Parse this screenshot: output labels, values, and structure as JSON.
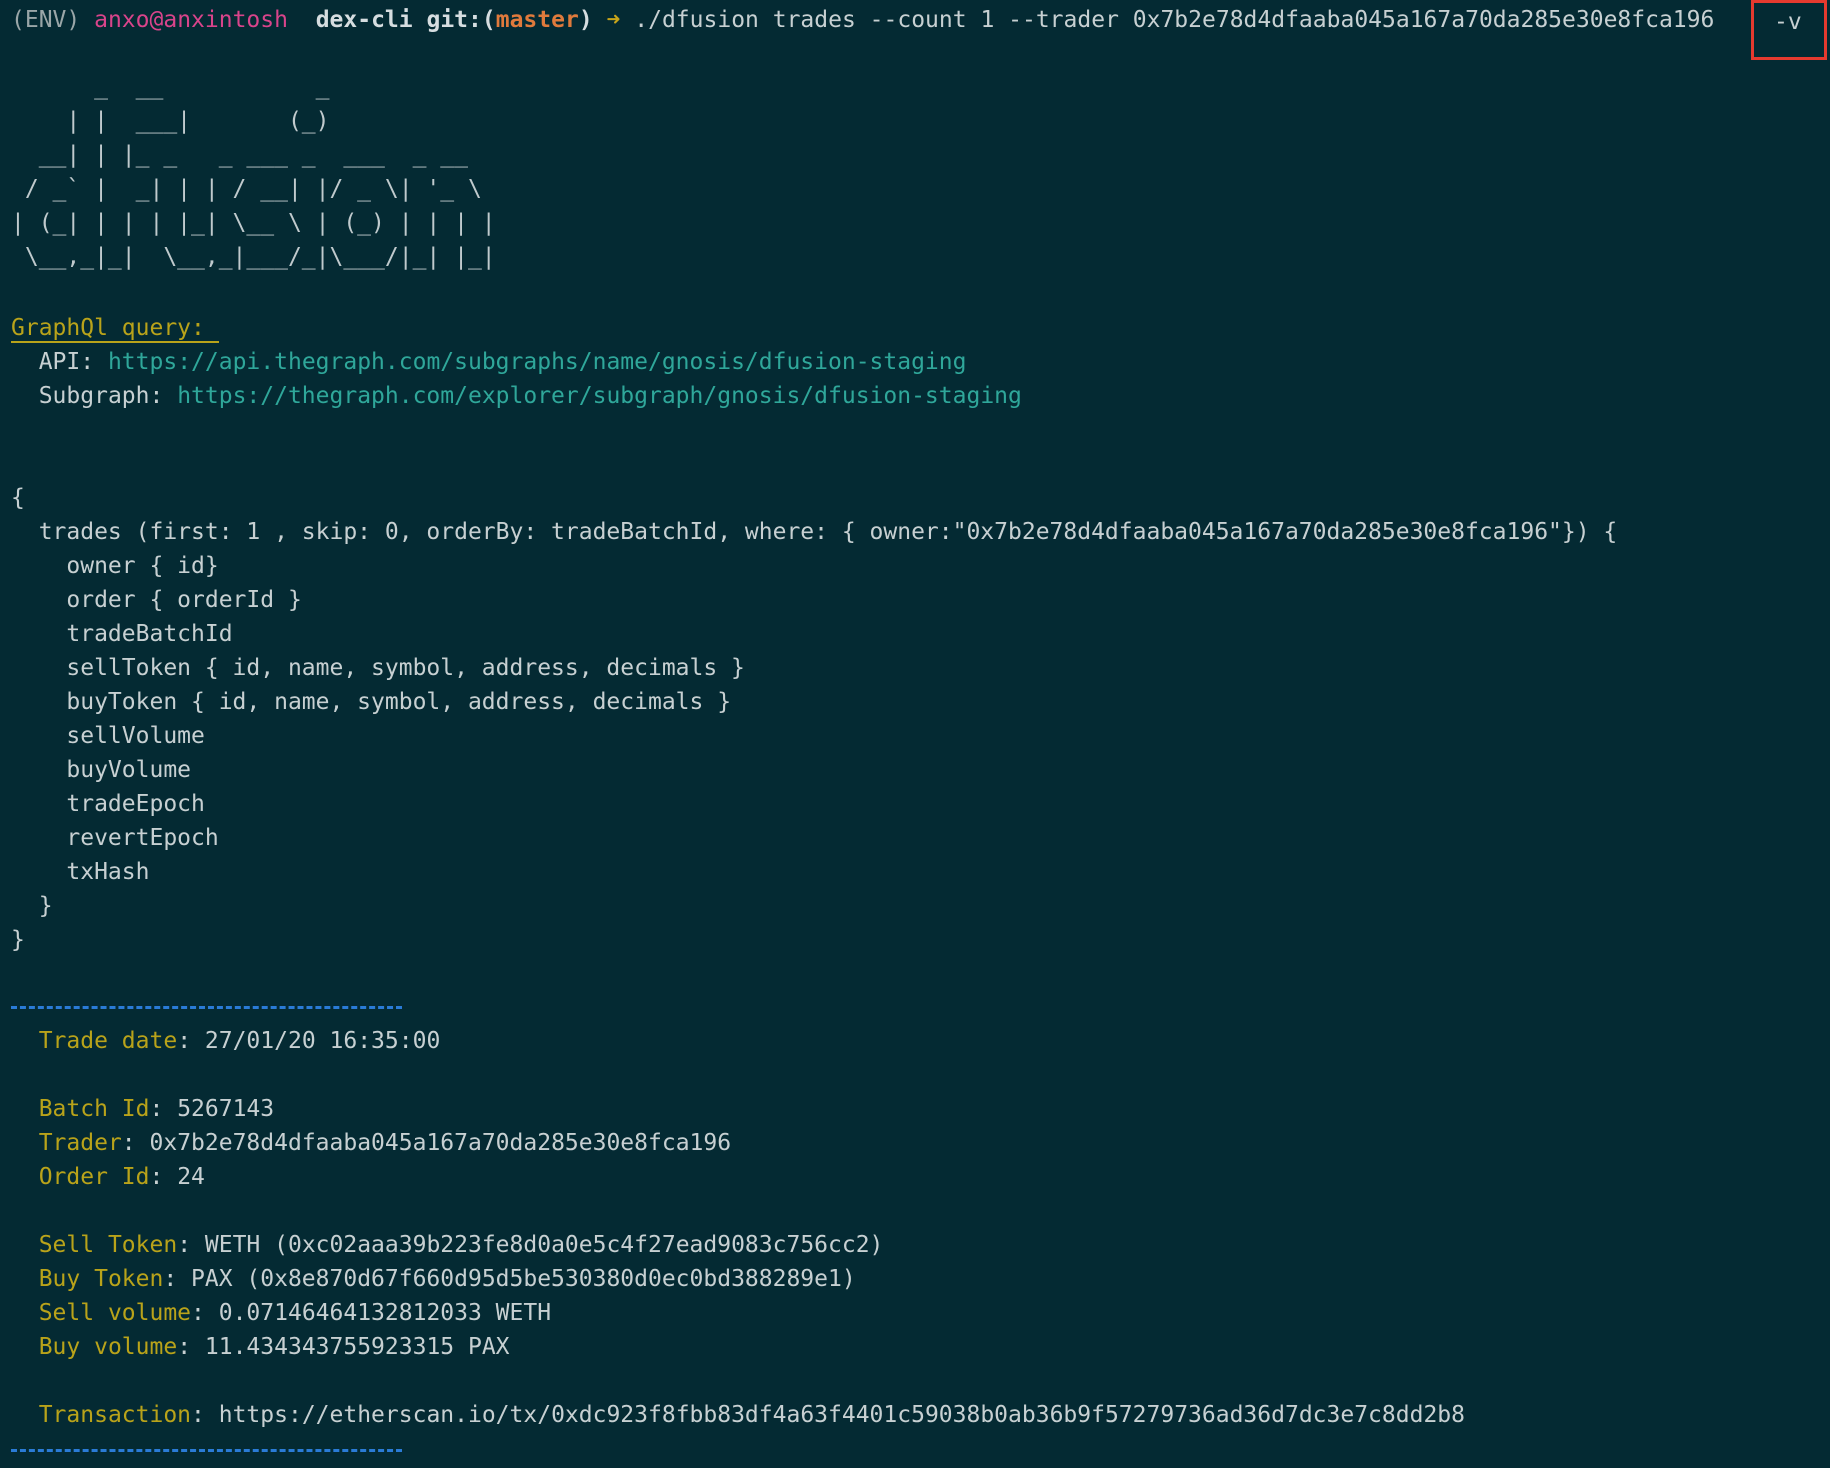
{
  "prompt": {
    "env": "(ENV)",
    "user": "anxo",
    "host": "@anxintosh",
    "dir": "dex-cli",
    "git_label": "git:(",
    "branch": "master",
    "git_close": ")",
    "arrow": "➜",
    "command": "./dfusion trades --count 1 --trader 0x7b2e78d4dfaaba045a167a70da285e30e8fca196",
    "flag": "-v"
  },
  "banner": [
    "      _  __           _",
    "    | |  ___|       (_)",
    "  __| | |_ _   _ ___ _  ___  _ __",
    " / _` |  _| | | / __| |/ _ \\| '_ \\",
    "| (_| | | | |_| \\__ \\ | (_) | | | |",
    " \\__,_|_|  \\__,_|___/_|\\___/|_| |_|"
  ],
  "query_section": {
    "title": "GraphQl query: ",
    "api_label": "API: ",
    "api_url": "https://api.thegraph.com/subgraphs/name/gnosis/dfusion-staging",
    "subgraph_label": "Subgraph: ",
    "subgraph_url": "https://thegraph.com/explorer/subgraph/gnosis/dfusion-staging"
  },
  "query_lines": [
    "{",
    "  trades (first: 1 , skip: 0, orderBy: tradeBatchId, where: { owner:\"0x7b2e78d4dfaaba045a167a70da285e30e8fca196\"}) {",
    "    owner { id}",
    "    order { orderId }",
    "    tradeBatchId",
    "    sellToken { id, name, symbol, address, decimals }",
    "    buyToken { id, name, symbol, address, decimals }",
    "    sellVolume",
    "    buyVolume",
    "    tradeEpoch",
    "    revertEpoch",
    "    txHash",
    "  }",
    "}"
  ],
  "trade": {
    "date_label": "Trade date",
    "date_value": "27/01/20 16:35:00",
    "batch_label": "Batch Id",
    "batch_value": "5267143",
    "trader_label": "Trader",
    "trader_value": "0x7b2e78d4dfaaba045a167a70da285e30e8fca196",
    "order_label": "Order Id",
    "order_value": "24",
    "sell_token_label": "Sell Token",
    "sell_token_value": "WETH (0xc02aaa39b223fe8d0a0e5c4f27ead9083c756cc2)",
    "buy_token_label": "Buy Token",
    "buy_token_value": "PAX (0x8e870d67f660d95d5be530380d0ec0bd388289e1)",
    "sell_volume_label": "Sell volume",
    "sell_volume_value": "0.07146464132812033 WETH",
    "buy_volume_label": "Buy volume",
    "buy_volume_value": "11.434343755923315 PAX",
    "tx_label": "Transaction",
    "tx_value": "https://etherscan.io/tx/0xdc923f8fbb83df4a63f4401c59038b0ab36b9f57279736ad36d7dc3e7c8dd2b8"
  },
  "colors": {
    "background": "#042a33",
    "user": "#d9448b",
    "branch": "#e07a3c",
    "label": "#b9a31a",
    "url": "#2fa79a",
    "separator": "#2a7bd6",
    "highlight_box": "#e53a2f"
  }
}
